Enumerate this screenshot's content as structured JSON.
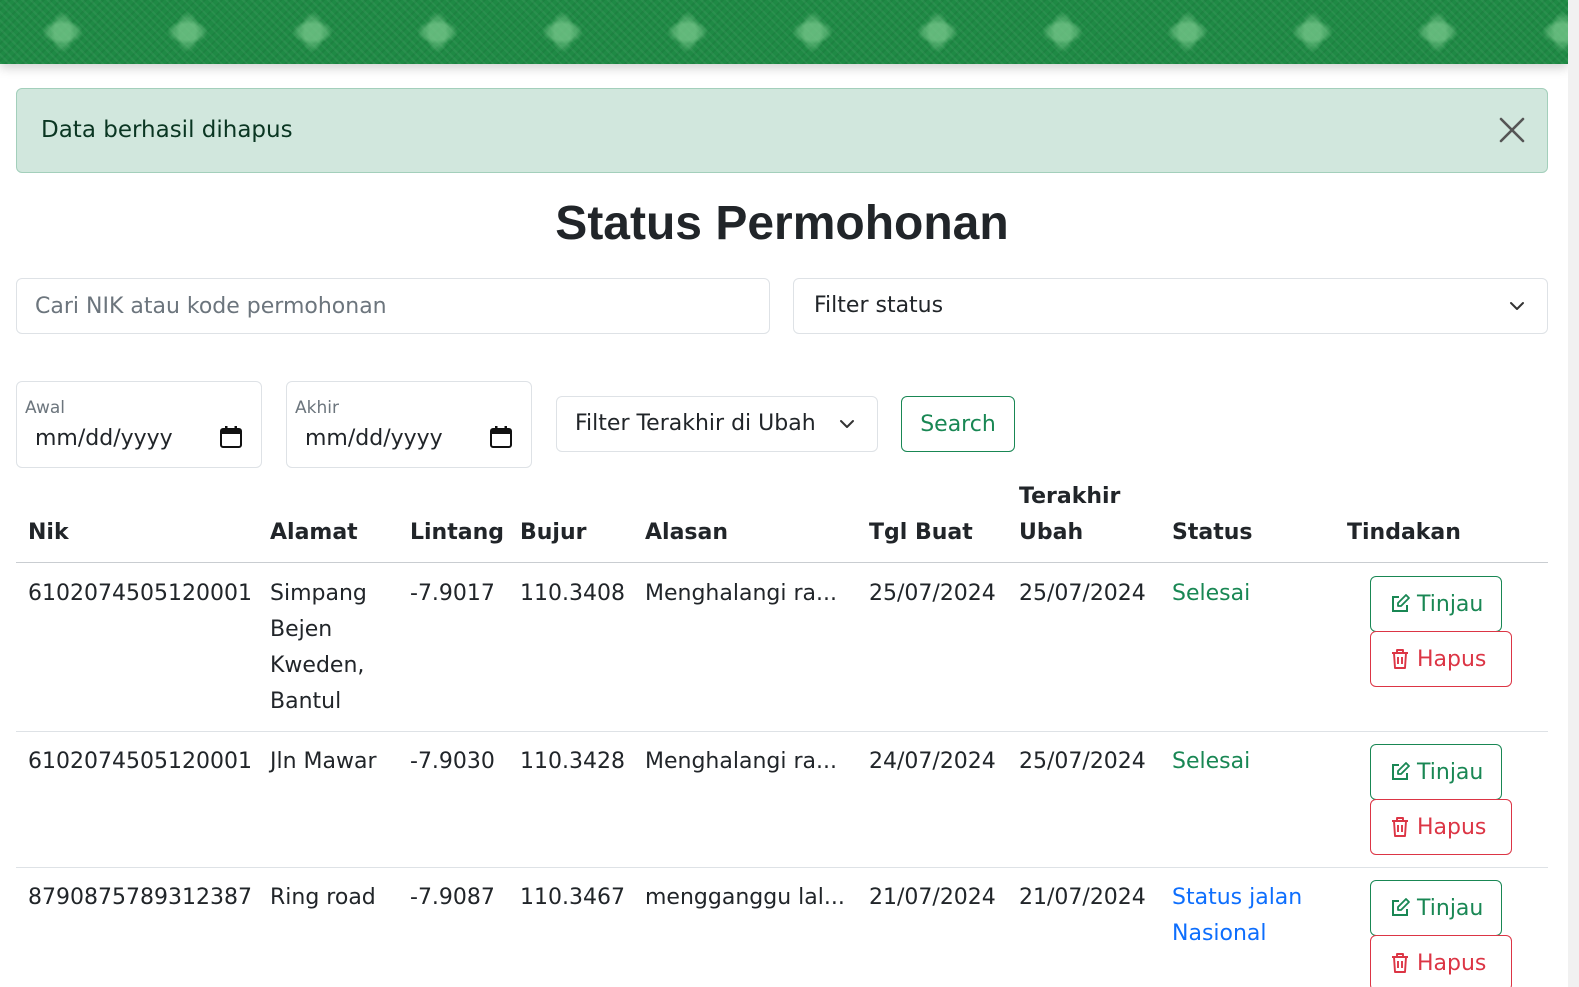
{
  "alert": {
    "message": "Data berhasil dihapus"
  },
  "page_title": "Status Permohonan",
  "filters": {
    "search_placeholder": "Cari NIK atau kode permohonan",
    "status_select": "Filter status",
    "date_start": {
      "label": "Awal",
      "value": "mm/dd/yyyy"
    },
    "date_end": {
      "label": "Akhir",
      "value": "mm/dd/yyyy"
    },
    "updated_select": "Filter Terakhir di Ubah",
    "search_button": "Search"
  },
  "table": {
    "headers": {
      "nik": "Nik",
      "alamat": "Alamat",
      "lintang": "Lintang",
      "bujur": "Bujur",
      "alasan": "Alasan",
      "tgl_buat": "Tgl Buat",
      "terakhir_ubah": "Terakhir Ubah",
      "status": "Status",
      "tindakan": "Tindakan"
    },
    "rows": [
      {
        "nik": "6102074505120001",
        "alamat": "Simpang Bejen Kweden, Bantul",
        "lintang": "-7.9017",
        "bujur": "110.3408",
        "alasan": "Menghalangi ra...",
        "tgl_buat": "25/07/2024",
        "terakhir_ubah": "25/07/2024",
        "status": "Selesai",
        "status_color": "#198754"
      },
      {
        "nik": "6102074505120001",
        "alamat": "Jln Mawar",
        "lintang": "-7.9030",
        "bujur": "110.3428",
        "alasan": "Menghalangi ra...",
        "tgl_buat": "24/07/2024",
        "terakhir_ubah": "25/07/2024",
        "status": "Selesai",
        "status_color": "#198754"
      },
      {
        "nik": "8790875789312387",
        "alamat": "Ring road",
        "lintang": "-7.9087",
        "bujur": "110.3467",
        "alasan": "mengganggu lal...",
        "tgl_buat": "21/07/2024",
        "terakhir_ubah": "21/07/2024",
        "status": "Status jalan Nasional",
        "status_color": "#0d6efd"
      }
    ],
    "actions": {
      "review": "Tinjau",
      "delete": "Hapus"
    }
  },
  "colors": {
    "brand_green": "#198754",
    "danger": "#dc3545",
    "link_blue": "#0d6efd",
    "alert_bg": "#d1e7dd"
  },
  "icons": {
    "close": "close-icon",
    "chevron": "chevron-down-icon",
    "calendar": "calendar-icon",
    "edit": "edit-icon",
    "trash": "trash-icon"
  }
}
